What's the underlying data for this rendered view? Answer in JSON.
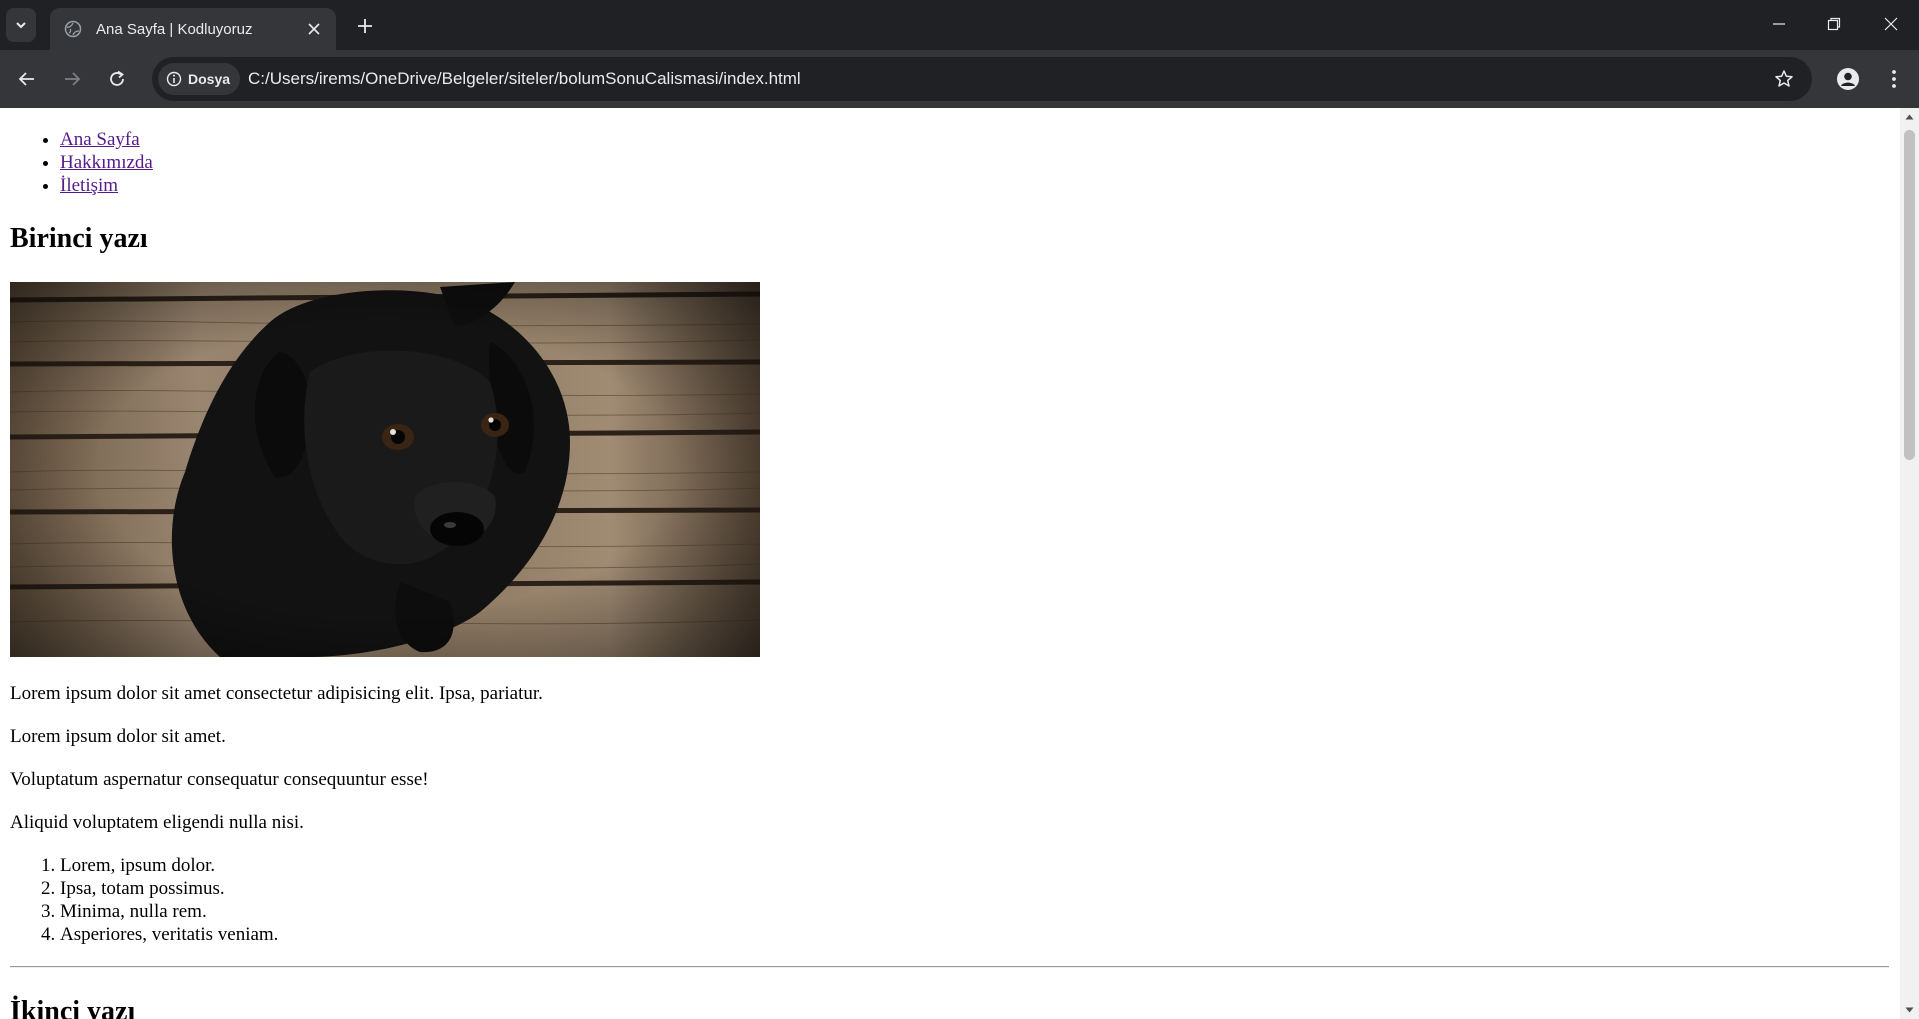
{
  "browser": {
    "tab_title": "Ana Sayfa | Kodluyoruz",
    "site_chip_label": "Dosya",
    "url": "C:/Users/irems/OneDrive/Belgeler/siteler/bolumSonuCalismasi/index.html",
    "colors": {
      "tabbar_bg": "#202124",
      "toolbar_bg": "#35363a",
      "omnibox_bg": "#202124",
      "text": "#e8eaed"
    },
    "icons": [
      "tab-search-icon",
      "globe-icon",
      "close-icon",
      "plus-icon",
      "minimize-icon",
      "restore-icon",
      "window-close-icon",
      "back-arrow-icon",
      "forward-arrow-icon",
      "reload-icon",
      "info-icon",
      "star-icon",
      "profile-icon",
      "more-vert-icon"
    ]
  },
  "page": {
    "nav_links": [
      "Ana Sayfa",
      "Hakkımızda",
      "İletişim"
    ],
    "link_color": "#551a8b",
    "first_heading": "Birinci yazı",
    "paragraphs": [
      "Lorem ipsum dolor sit amet consectetur adipisicing elit. Ipsa, pariatur.",
      "Lorem ipsum dolor sit amet.",
      "Voluptatum aspernatur consequatur consequuntur esse!",
      "Aliquid voluptatem eligendi nulla nisi."
    ],
    "ordered_list": [
      "Lorem, ipsum dolor.",
      "Ipsa, totam possimus.",
      "Minima, nulla rem.",
      "Asperiores, veritatis veniam."
    ],
    "second_heading": "İkinci yazı",
    "image_subject": "black puppy on wooden floor"
  }
}
